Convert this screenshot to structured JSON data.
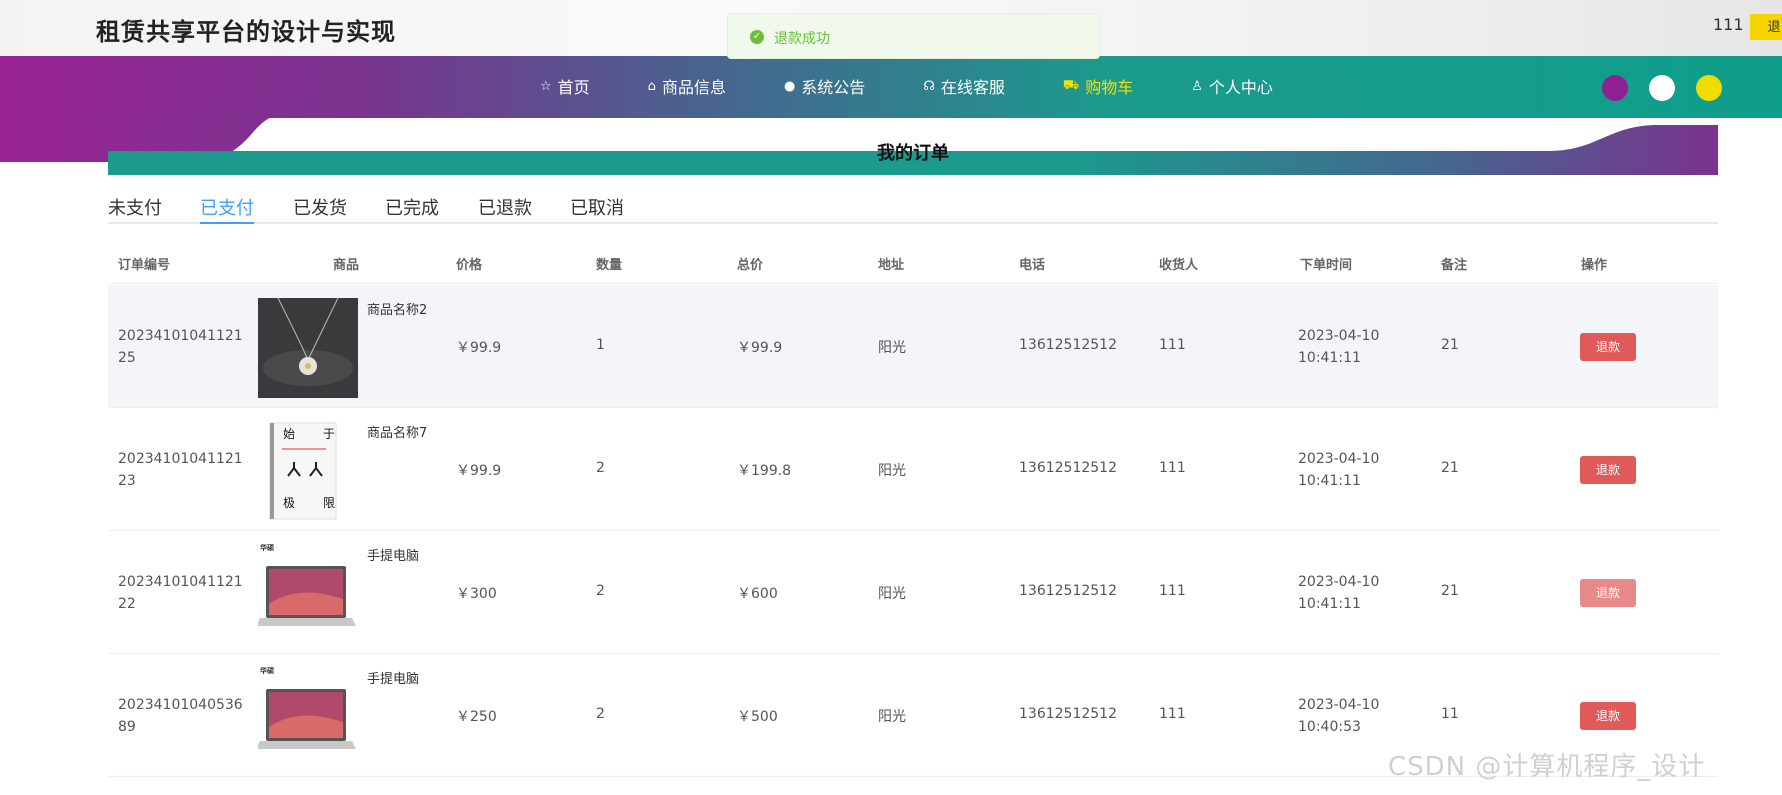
{
  "header": {
    "site_title": "租赁共享平台的设计与实现",
    "username": "111",
    "logout_label": "退"
  },
  "toast": {
    "message": "退款成功",
    "icon": "check-circle-icon",
    "color": "#67c23a"
  },
  "nav": {
    "items": [
      {
        "label": "首页",
        "icon": "star-icon"
      },
      {
        "label": "商品信息",
        "icon": "bag-icon"
      },
      {
        "label": "系统公告",
        "icon": "info-icon"
      },
      {
        "label": "在线客服",
        "icon": "headset-icon"
      },
      {
        "label": "购物车",
        "icon": "cart-icon"
      },
      {
        "label": "个人中心",
        "icon": "user-icon"
      }
    ],
    "active_index": 4,
    "theme_colors": [
      "#8e1f94",
      "#ffffff",
      "#f2dc00"
    ]
  },
  "page": {
    "title": "我的订单"
  },
  "tabs": {
    "items": [
      "未支付",
      "已支付",
      "已发货",
      "已完成",
      "已退款",
      "已取消"
    ],
    "active_index": 1
  },
  "table": {
    "columns": [
      "订单编号",
      "商品",
      "价格",
      "数量",
      "总价",
      "地址",
      "电话",
      "收货人",
      "下单时间",
      "备注",
      "操作"
    ],
    "rows": [
      {
        "order_no": "2023410104112125",
        "product": "商品名称2",
        "price": "￥99.9",
        "qty": "1",
        "total": "￥99.9",
        "address": "阳光",
        "phone": "13612512512",
        "receiver": "111",
        "time": "2023-04-10 10:41:11",
        "note": "21",
        "action": "退款"
      },
      {
        "order_no": "2023410104112123",
        "product": "商品名称7",
        "price": "￥99.9",
        "qty": "2",
        "total": "￥199.8",
        "address": "阳光",
        "phone": "13612512512",
        "receiver": "111",
        "time": "2023-04-10 10:41:11",
        "note": "21",
        "action": "退款"
      },
      {
        "order_no": "2023410104112122",
        "product": "手提电脑",
        "price": "￥300",
        "qty": "2",
        "total": "￥600",
        "address": "阳光",
        "phone": "13612512512",
        "receiver": "111",
        "time": "2023-04-10 10:41:11",
        "note": "21",
        "action": "退款"
      },
      {
        "order_no": "2023410104053689",
        "product": "手提电脑",
        "price": "￥250",
        "qty": "2",
        "total": "￥500",
        "address": "阳光",
        "phone": "13612512512",
        "receiver": "111",
        "time": "2023-04-10 10:40:53",
        "note": "11",
        "action": "退款"
      }
    ]
  },
  "book_cover": {
    "chars": [
      "始",
      "于",
      "极",
      "限"
    ]
  },
  "laptop_brand": "华硕",
  "watermark": "CSDN @计算机程序_设计"
}
